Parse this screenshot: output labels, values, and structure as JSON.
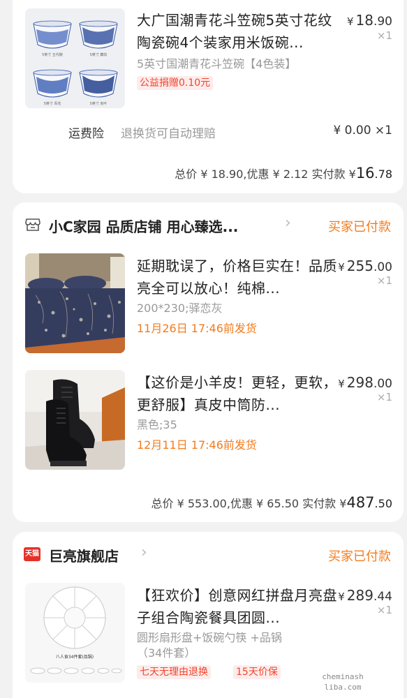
{
  "order1": {
    "item": {
      "title": "大广国潮青花斗笠碗5英寸花纹陶瓷碗4个装家用米饭碗...",
      "price_int": "18",
      "price_dec": ".90",
      "qty": "×1",
      "sku": "5英寸国潮青花斗笠碗【4色装】",
      "tag": "公益捐赠0.10元"
    },
    "insurance": {
      "label": "运费险",
      "desc": "退换货可自动理赔",
      "price": "¥ 0.00 ×1"
    },
    "total": {
      "prefix": "总价 ¥ 18.90,优惠 ¥ 2.12  实付款 ¥",
      "amount_int": "16",
      "amount_dec": ".78"
    }
  },
  "order2": {
    "store_name": "小C家园 品质店铺 用心臻选...",
    "status": "买家已付款",
    "items": [
      {
        "title": "延期耽误了，价格巨实在！品质亮全可以放心！纯棉...",
        "price_int": "255",
        "price_dec": ".00",
        "qty": "×1",
        "sku": "200*230;驿恋灰",
        "ship": "11月26日 17:46前发货"
      },
      {
        "title": "【这价是小羊皮！更轻，更软，更舒服】真皮中筒防...",
        "price_int": "298",
        "price_dec": ".00",
        "qty": "×1",
        "sku": "黑色;35",
        "ship": "12月11日 17:46前发货"
      }
    ],
    "total": {
      "prefix": "总价 ¥ 553.00,优惠 ¥ 65.50  实付款 ¥",
      "amount_int": "487",
      "amount_dec": ".50"
    }
  },
  "order3": {
    "store_badge": "天猫",
    "store_name": "巨亮旗舰店",
    "status": "买家已付款",
    "item": {
      "title": "【狂欢价】创意网红拼盘月亮盘子组合陶瓷餐具团圆...",
      "price_int": "289",
      "price_dec": ".44",
      "qty": "×1",
      "sku": "圆形扇形盘+饭碗勺筷 +品锅（34件套）",
      "tag1": "七天无理由退换",
      "tag2": "15天价保",
      "thumb_caption": "八人食34件套(品锅)"
    }
  },
  "bowl_labels": [
    "5英寸 五代碗",
    "5英寸 藏纹",
    "5英寸 青花",
    "5英寸 夹叶"
  ],
  "watermark": [
    "cheminash",
    "liba.com"
  ],
  "colors": {
    "accent_orange": "#f37b1d",
    "tag_red": "#f0452c",
    "background": "#f2f2f2"
  },
  "icons": {
    "store": "shop-icon",
    "chevron": "chevron-right-icon",
    "tmall": "tmall-badge-icon"
  }
}
